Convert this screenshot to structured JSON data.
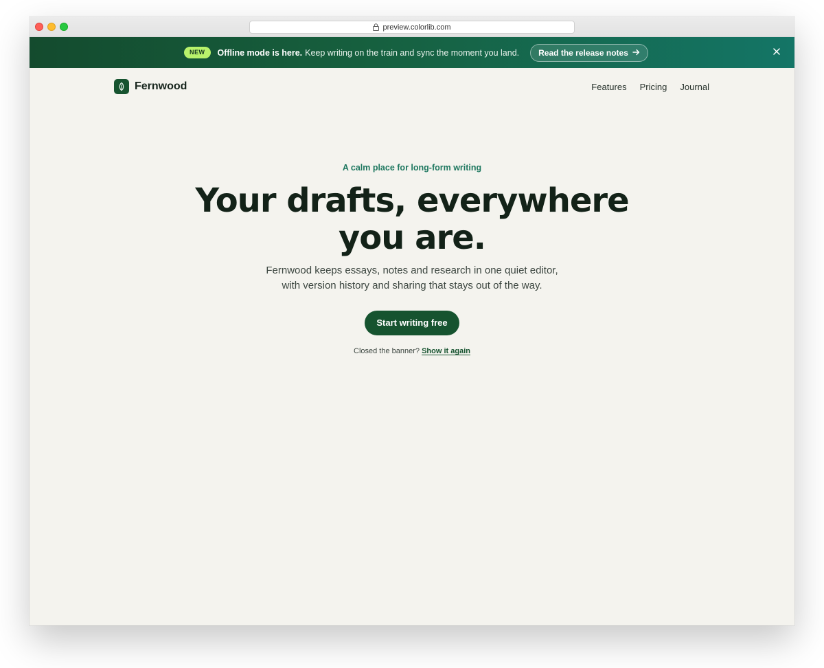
{
  "browser": {
    "url": "preview.colorlib.com"
  },
  "banner": {
    "badge": "NEW",
    "headline": "Offline mode is here.",
    "message": "Keep writing on the train and sync the moment you land.",
    "cta_label": "Read the release notes",
    "cta_icon": "arrow-right-icon",
    "close_icon": "close-icon",
    "colors": {
      "start": "#144b2e",
      "end": "#147566",
      "badge": "#b8f26b"
    }
  },
  "nav": {
    "brand": "Fernwood",
    "brand_icon": "leaf-icon",
    "links": [
      "Features",
      "Pricing",
      "Journal"
    ]
  },
  "hero": {
    "eyebrow": "A calm place for long-form writing",
    "headline_line1": "Your drafts, everywhere",
    "headline_line2": "you are.",
    "subcopy_line1": "Fernwood keeps essays, notes and research in one quiet editor,",
    "subcopy_line2": "with version history and sharing that stays out of the way.",
    "cta_label": "Start writing free",
    "reshow_text": "Closed the banner?",
    "reshow_link": "Show it again"
  },
  "theme": {
    "accent": "#16532f",
    "background": "#f4f3ee",
    "eyebrow": "#1f7860"
  }
}
